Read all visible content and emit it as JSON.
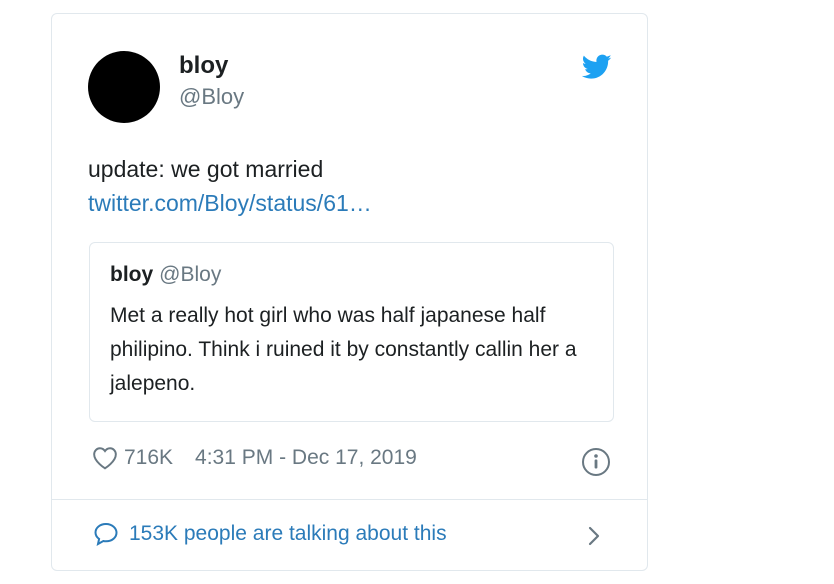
{
  "author": {
    "name": "bloy",
    "handle": "@Bloy"
  },
  "tweet": {
    "text": "update: we got married",
    "link": "twitter.com/Bloy/status/61…"
  },
  "quoted": {
    "name": "bloy",
    "handle": "@Bloy",
    "text": "Met a really hot girl who was half japanese half philipino. Think i ruined it by constantly callin her a jalepeno."
  },
  "meta": {
    "likes": "716K",
    "timestamp": "4:31 PM - Dec 17, 2019"
  },
  "footer": {
    "conversation": "153K people are talking about this"
  },
  "icons": {
    "brand": "twitter-bird-icon",
    "like": "heart-icon",
    "info": "info-icon",
    "reply": "speech-bubble-icon",
    "more": "chevron-right-icon"
  },
  "colors": {
    "link": "#2b7bb9",
    "twitter_blue": "#1da1f2",
    "muted": "#697882",
    "border": "#e1e8ed"
  }
}
